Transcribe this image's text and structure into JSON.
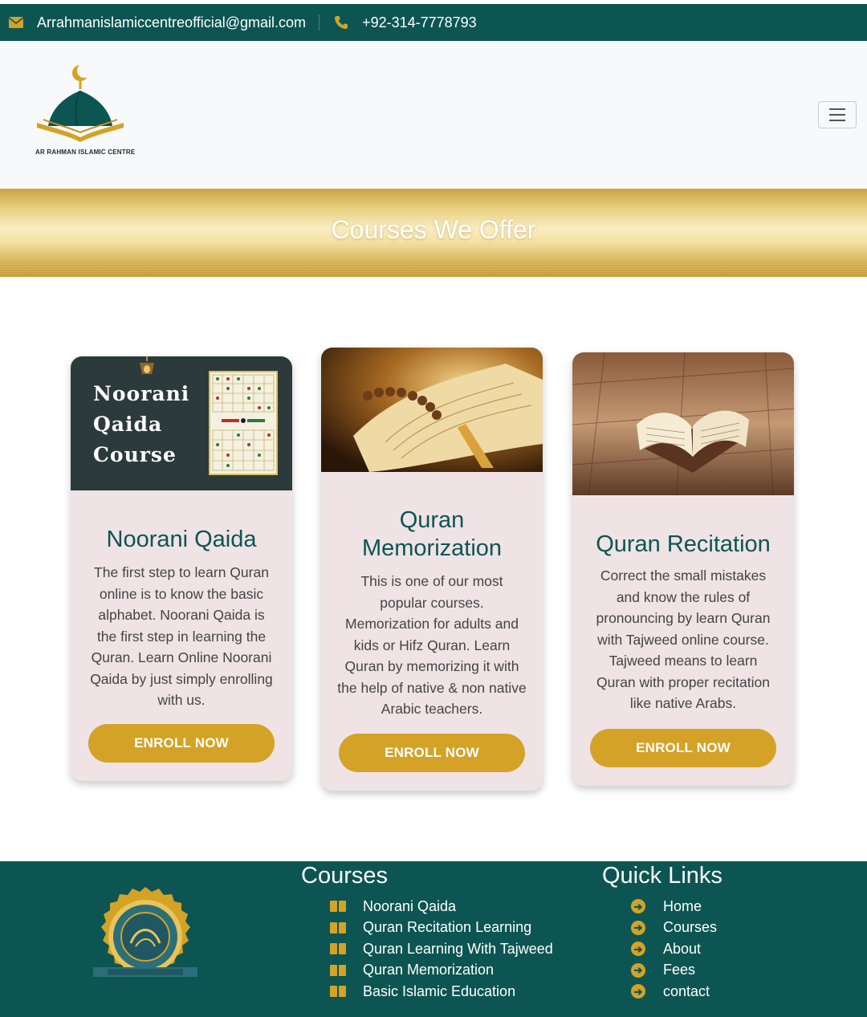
{
  "topbar": {
    "email_icon": "envelope-icon",
    "email": "Arrahmanislamiccentreofficial@gmail.com",
    "phone_icon": "phone-icon",
    "phone": "+92-314-7778793"
  },
  "header": {
    "logo_text": "AR RAHMAN ISLAMIC CENTRE",
    "menu_icon": "hamburger-menu-icon"
  },
  "banner": {
    "title": "Courses We Offer"
  },
  "courses": [
    {
      "image_text": [
        "Noorani",
        "Qaida",
        "Course"
      ],
      "title": "Noorani Qaida",
      "description": "The first step to learn Quran online is to know the basic alphabet. Noorani Qaida is the first step in learning the Quran. Learn Online Noorani Qaida by just simply enrolling with us.",
      "button": "ENROLL NOW"
    },
    {
      "title": "Quran Memorization",
      "description": "This is one of our most popular courses. Memorization for adults and kids or Hifz Quran. Learn Quran by memorizing it with the help of native & non native Arabic teachers.",
      "button": "ENROLL NOW"
    },
    {
      "title": "Quran Recitation",
      "description": "Correct the small mistakes and know the rules of pronouncing by learn Quran with Tajweed online course. Tajweed means to learn Quran with proper recitation like native Arabs.",
      "button": "ENROLL NOW"
    }
  ],
  "footer": {
    "courses_heading": "Courses",
    "courses": [
      "Noorani Qaida",
      "Quran Recitation Learning",
      "Quran Learning With Tajweed",
      "Quran Memorization",
      "Basic Islamic Education"
    ],
    "links_heading": "Quick Links",
    "links": [
      "Home",
      "Courses",
      "About",
      "Fees",
      "contact"
    ]
  },
  "colors": {
    "primary_teal": "#0c5552",
    "gold": "#d4a226",
    "card_bg": "#efe3e6"
  }
}
